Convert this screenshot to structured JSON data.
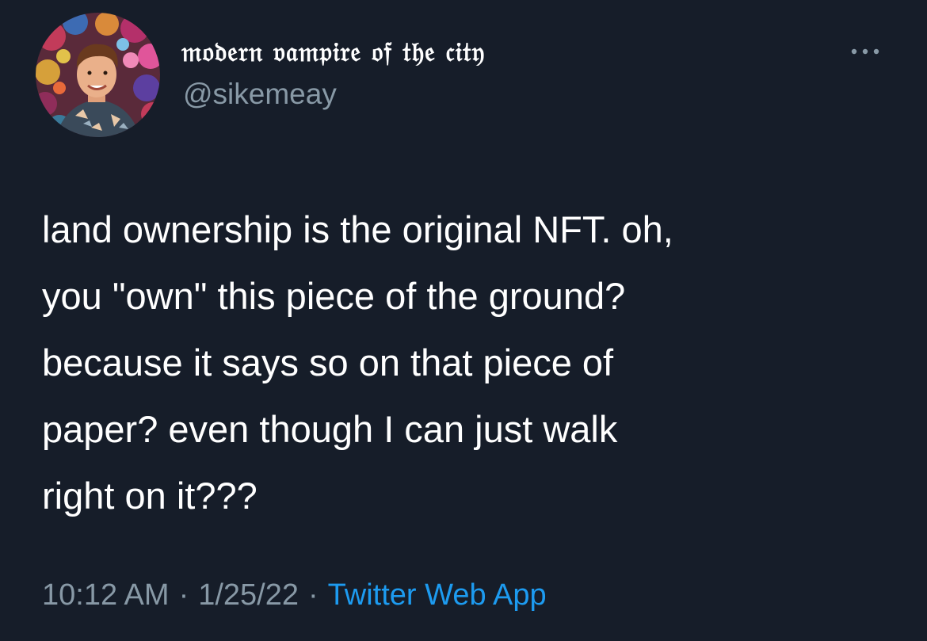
{
  "profile": {
    "display_name": "𝔪𝔬𝔡𝔢𝔯𝔫 𝔳𝔞𝔪𝔭𝔦𝔯𝔢 𝔬𝔣 𝔱𝔥𝔢 𝔠𝔦𝔱𝔶",
    "handle": "@sikemeay",
    "avatar_icon": "profile-photo"
  },
  "tweet": {
    "lines": [
      "land ownership is the original NFT. oh,",
      "you \"own\" this piece of the ground?",
      "because it says so on that piece of",
      "paper? even though I can just walk",
      "right on it???"
    ]
  },
  "meta": {
    "time": "10:12 AM",
    "date": "1/25/22",
    "separator": "·",
    "source": "Twitter Web App"
  },
  "colors": {
    "background": "#161d29",
    "text": "#ffffff",
    "secondary_text": "#8899a6",
    "link": "#1d9bf0"
  },
  "icons": {
    "more": "more-horizontal-icon"
  }
}
